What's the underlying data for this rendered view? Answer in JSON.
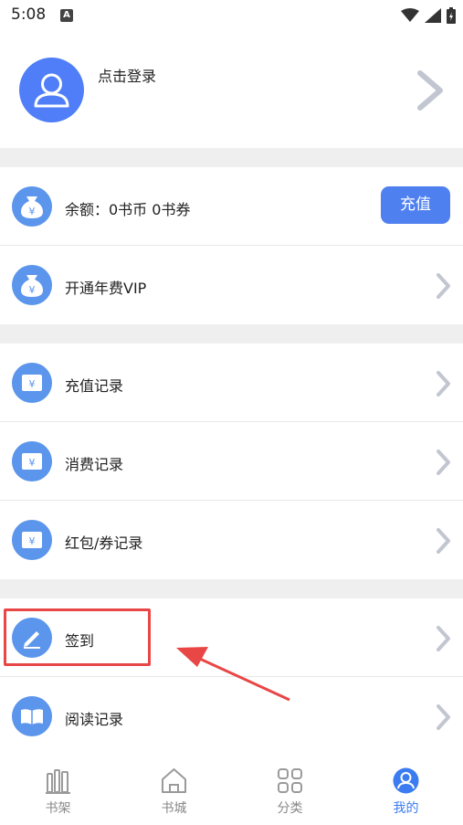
{
  "status_bar": {
    "time": "5:08",
    "notification_badge": "A"
  },
  "profile": {
    "login_label": "点击登录"
  },
  "balance_row": {
    "label": "余额：0书币  0书券",
    "button_label": "充值"
  },
  "vip_row": {
    "label": "开通年费VIP"
  },
  "records": [
    {
      "label": "充值记录"
    },
    {
      "label": "消费记录"
    },
    {
      "label": "红包/券记录"
    }
  ],
  "signin_row": {
    "label": "签到"
  },
  "reading_row": {
    "label": "阅读记录"
  },
  "bottom_nav": [
    {
      "label": "书架",
      "icon": "bookshelf-icon",
      "active": false
    },
    {
      "label": "书城",
      "icon": "home-icon",
      "active": false
    },
    {
      "label": "分类",
      "icon": "category-icon",
      "active": false
    },
    {
      "label": "我的",
      "icon": "profile-icon",
      "active": true
    }
  ],
  "colors": {
    "accent": "#4f80f0",
    "icon_blue": "#5b95ec",
    "highlight_red": "#e94646",
    "gap_gray": "#efefef",
    "nav_active": "#3b7cf0"
  }
}
